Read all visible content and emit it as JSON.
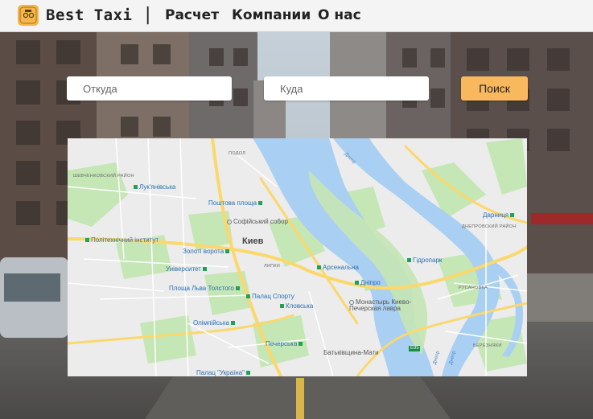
{
  "header": {
    "brand": "Best Taxi",
    "separator": "|",
    "nav": [
      "Расчет",
      "Компании",
      "О нас"
    ]
  },
  "search": {
    "from_placeholder": "Откуда",
    "to_placeholder": "Куда",
    "button_label": "Поиск"
  },
  "map": {
    "city": "Киев",
    "districts": [
      "ПОДОЛ",
      "ШЕВЧЕНКОВСКИЙ РАЙОН",
      "ДНЕПРОВСКИЙ РАЙОН",
      "РУСАНОВКА",
      "БЕРЕЗНЯКИ",
      "ЛИПКИ"
    ],
    "places": [
      "Лук'янівська",
      "Поштова площа",
      "Софійський собор",
      "Політехнічний інститут",
      "Золоті ворота",
      "Університет",
      "Арсенальна",
      "Гідропарк",
      "Дніпро",
      "Площа Льва Толстого",
      "Палац Спорту",
      "Кловська",
      "Монастырь Киево-Печерская лавра",
      "Олімпійська",
      "Печерська",
      "Батьківщина-Мати",
      "Палац \"Україна\"",
      "Дарниця"
    ],
    "rivers": [
      "Днепр",
      "Днепр",
      "Днепр"
    ],
    "roads": [
      "E95"
    ],
    "colors": {
      "water": "#a9cff2",
      "park": "#c5e6b5",
      "road_major": "#fbd86b",
      "land": "#ececec",
      "accent": "#f8b85d"
    }
  }
}
